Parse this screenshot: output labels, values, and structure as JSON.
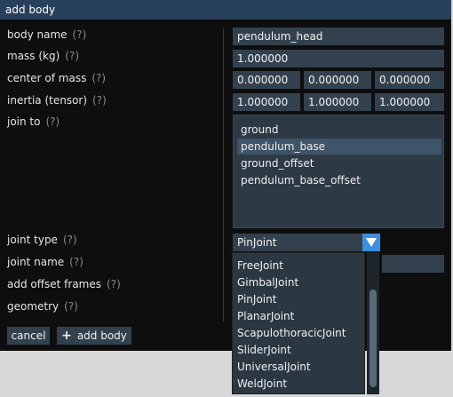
{
  "window": {
    "title": "add body"
  },
  "labels": {
    "body_name": "body name",
    "mass": "mass (kg)",
    "center_of_mass": "center of mass",
    "inertia": "inertia (tensor)",
    "join_to": "join to",
    "joint_type": "joint type",
    "joint_name": "joint name",
    "add_offset_frames": "add offset frames",
    "geometry": "geometry",
    "help": "(?)"
  },
  "fields": {
    "body_name": "pendulum_head",
    "mass": "1.000000",
    "center_of_mass": [
      "0.000000",
      "0.000000",
      "0.000000"
    ],
    "inertia": [
      "1.000000",
      "1.000000",
      "1.000000"
    ]
  },
  "join_to": {
    "items": [
      "ground",
      "pendulum_base",
      "ground_offset",
      "pendulum_base_offset"
    ],
    "selected_index": 1
  },
  "joint_type": {
    "selected": "PinJoint",
    "options": [
      "FreeJoint",
      "GimbalJoint",
      "PinJoint",
      "PlanarJoint",
      "ScapulothoracicJoint",
      "SliderJoint",
      "UniversalJoint",
      "WeldJoint"
    ]
  },
  "buttons": {
    "cancel": "cancel",
    "add_body": "add body"
  },
  "colors": {
    "titlebar": "#29405a",
    "accent": "#3d8fe0",
    "field": "#33414e",
    "selection": "#3f5468"
  }
}
